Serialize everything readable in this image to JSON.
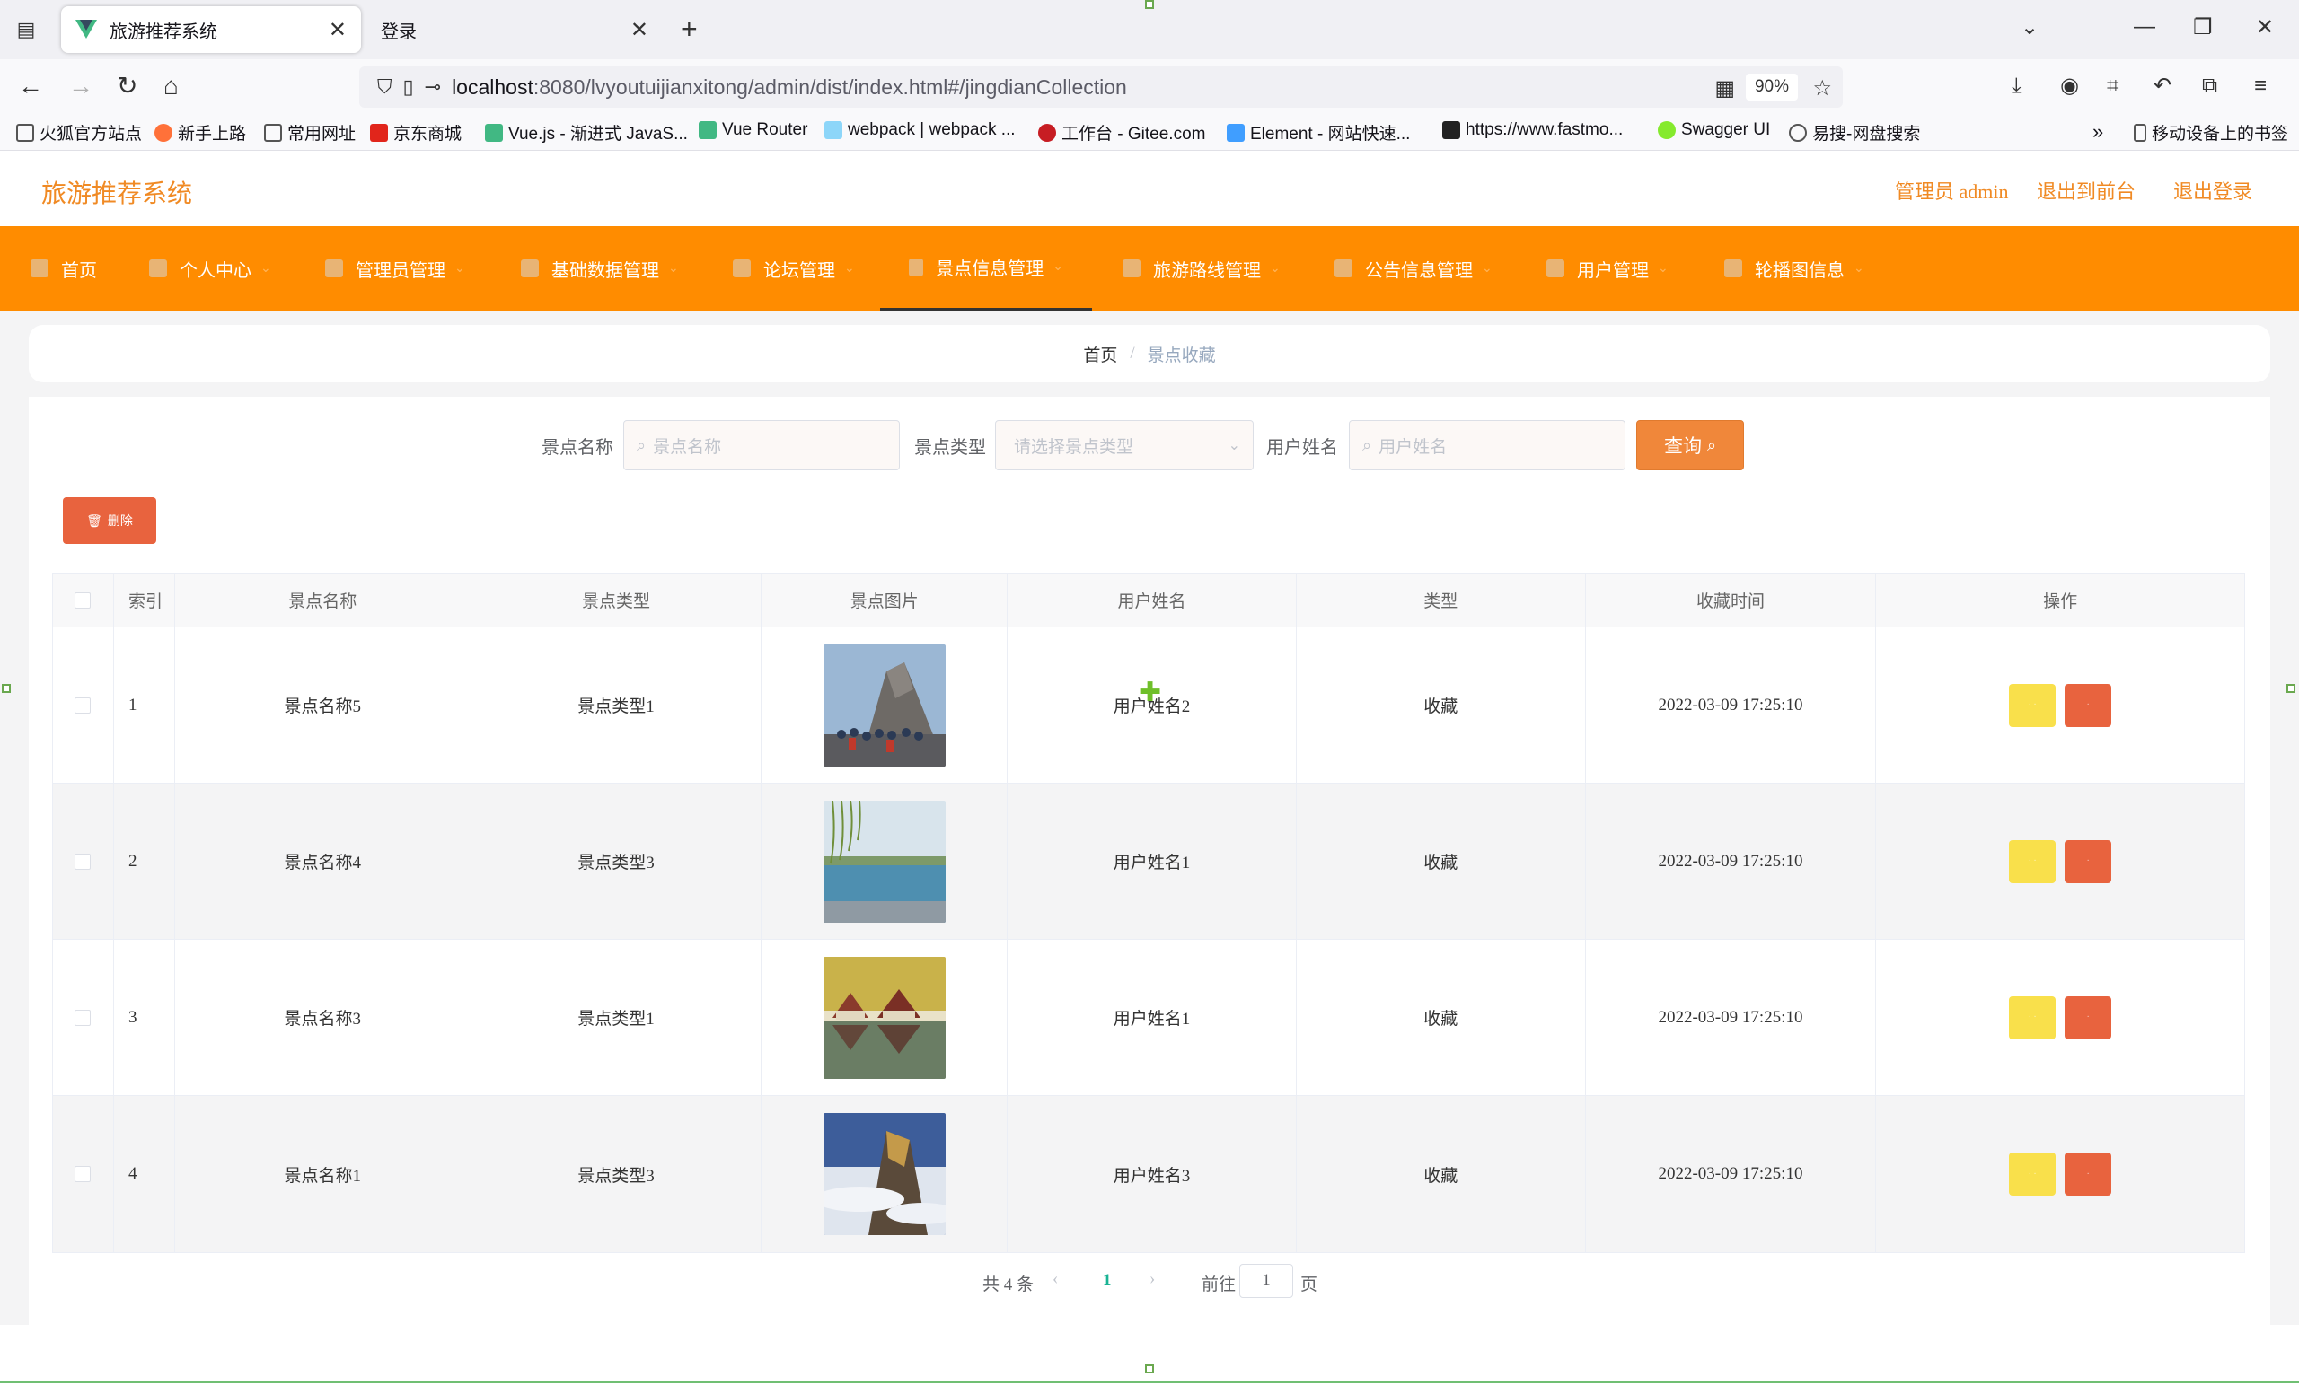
{
  "browser": {
    "tabs": [
      {
        "title": "旅游推荐系统",
        "active": true
      },
      {
        "title": "登录",
        "active": false
      }
    ],
    "url_host": "localhost",
    "url_rest": ":8080/lvyoutuijianxitong/admin/dist/index.html#/jingdianCollection",
    "zoom": "90%",
    "bookmarks": [
      "火狐官方站点",
      "新手上路",
      "常用网址",
      "京东商城",
      "Vue.js - 渐进式 JavaS...",
      "Vue Router",
      "webpack | webpack ...",
      "工作台 - Gitee.com",
      "Element - 网站快速...",
      "https://www.fastmo...",
      "Swagger UI",
      "易搜-网盘搜索"
    ],
    "mobile_bookmarks": "移动设备上的书签"
  },
  "header": {
    "title": "旅游推荐系统",
    "user": "管理员 admin",
    "to_front": "退出到前台",
    "logout": "退出登录"
  },
  "menu": [
    {
      "label": "首页"
    },
    {
      "label": "个人中心"
    },
    {
      "label": "管理员管理"
    },
    {
      "label": "基础数据管理"
    },
    {
      "label": "论坛管理"
    },
    {
      "label": "景点信息管理",
      "active": true
    },
    {
      "label": "旅游路线管理"
    },
    {
      "label": "公告信息管理"
    },
    {
      "label": "用户管理"
    },
    {
      "label": "轮播图信息"
    }
  ],
  "breadcrumb": {
    "home": "首页",
    "current": "景点收藏"
  },
  "search": {
    "name_label": "景点名称",
    "name_placeholder": "景点名称",
    "type_label": "景点类型",
    "type_placeholder": "请选择景点类型",
    "user_label": "用户姓名",
    "user_placeholder": "用户姓名",
    "query_button": "查询"
  },
  "delete_button": "删除",
  "table": {
    "headers": [
      "索引",
      "景点名称",
      "景点类型",
      "景点图片",
      "用户姓名",
      "类型",
      "收藏时间",
      "操作"
    ],
    "rows": [
      {
        "index": "1",
        "name": "景点名称5",
        "type": "景点类型1",
        "user": "用户姓名2",
        "kind": "收藏",
        "time": "2022-03-09 17:25:10"
      },
      {
        "index": "2",
        "name": "景点名称4",
        "type": "景点类型3",
        "user": "用户姓名1",
        "kind": "收藏",
        "time": "2022-03-09 17:25:10"
      },
      {
        "index": "3",
        "name": "景点名称3",
        "type": "景点类型1",
        "user": "用户姓名1",
        "kind": "收藏",
        "time": "2022-03-09 17:25:10"
      },
      {
        "index": "4",
        "name": "景点名称1",
        "type": "景点类型3",
        "user": "用户姓名3",
        "kind": "收藏",
        "time": "2022-03-09 17:25:10"
      }
    ]
  },
  "pager": {
    "total": "共 4 条",
    "current": "1",
    "goto": "前往",
    "goto_value": "1",
    "page": "页"
  },
  "colors": {
    "accent": "#ff8c00",
    "title": "#f08a24",
    "danger": "#e8633e",
    "warning": "#f9e04b"
  }
}
